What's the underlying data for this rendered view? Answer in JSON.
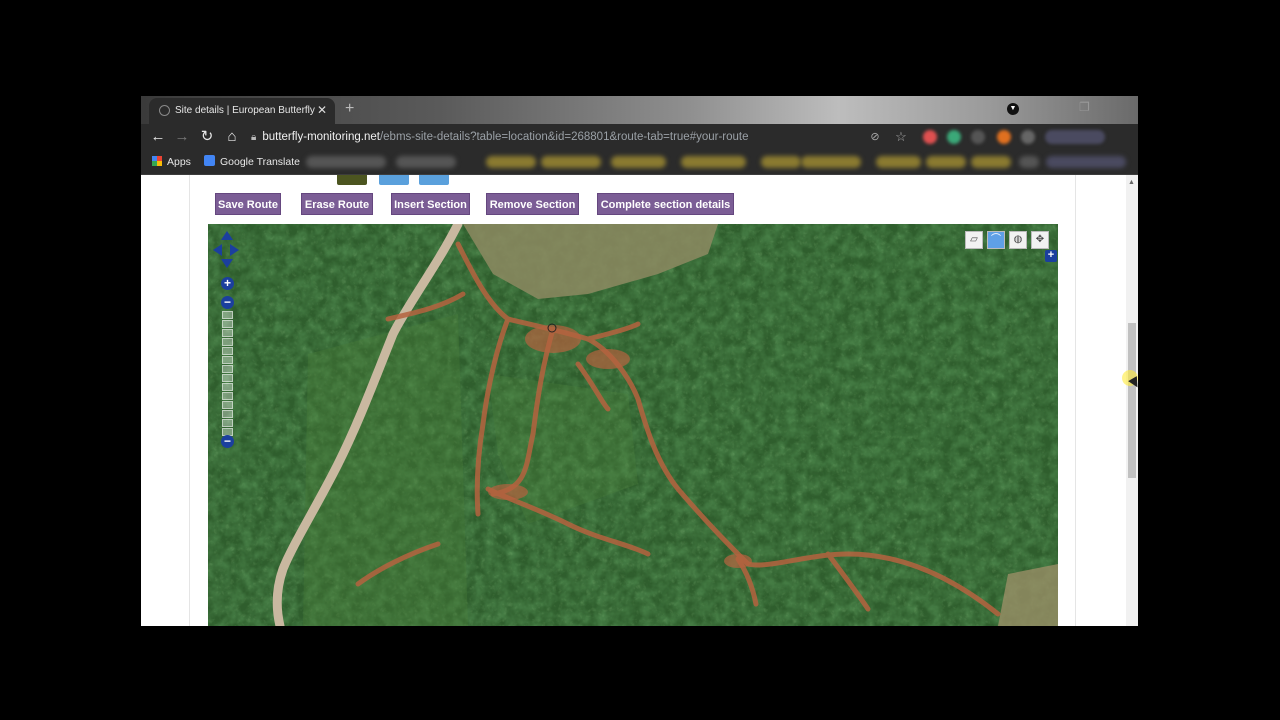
{
  "browser": {
    "tab": {
      "title": "Site details | European Butterfly M"
    },
    "address": {
      "host": "butterfly-monitoring.net",
      "path": "/ebms-site-details?table=location&id=268801&route-tab=true#your-route"
    },
    "bookmarks": [
      {
        "label": "Apps",
        "icon": "apps-grid-icon"
      },
      {
        "label": "Google Translate",
        "icon": "translate-icon"
      }
    ]
  },
  "page": {
    "route_buttons": [
      {
        "label": "Save Route"
      },
      {
        "label": "Erase Route"
      },
      {
        "label": "Insert Section"
      },
      {
        "label": "Remove Section"
      },
      {
        "label": "Complete section details"
      }
    ],
    "map": {
      "tools": [
        {
          "name": "navigate-icon",
          "active": false
        },
        {
          "name": "draw-line-icon",
          "active": true
        },
        {
          "name": "globe-icon",
          "active": false
        },
        {
          "name": "move-icon",
          "active": false
        }
      ],
      "zoom_levels": 15,
      "imagery": "satellite"
    }
  },
  "colors": {
    "button_bg": "#7b5d95",
    "map_control": "#1b3f9e",
    "browser_chrome": "#2b2b2b"
  }
}
